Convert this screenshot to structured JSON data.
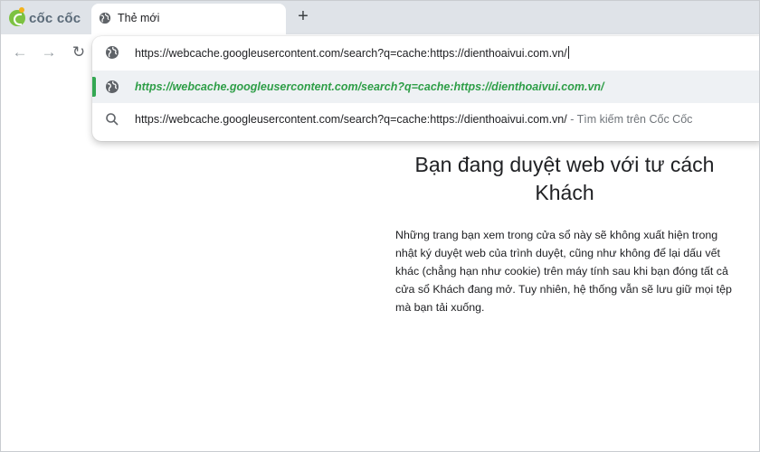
{
  "browser": {
    "brand": "cốc cốc",
    "tab": {
      "title": "Thẻ mới",
      "icon": "globe-icon"
    },
    "new_tab_icon": "+",
    "nav": {
      "back_icon": "←",
      "forward_icon": "→",
      "reload_icon": "↻"
    }
  },
  "omnibox": {
    "input_value": "https://webcache.googleusercontent.com/search?q=cache:https://dienthoaivui.com.vn/",
    "suggestions": [
      {
        "icon": "globe-icon",
        "text": "https://webcache.googleusercontent.com/search?q=cache:https://dienthoaivui.com.vn/"
      },
      {
        "icon": "search-icon",
        "text": "https://webcache.googleusercontent.com/search?q=cache:https://dienthoaivui.com.vn/",
        "hint": "- Tìm kiếm trên Cốc Cốc"
      }
    ]
  },
  "page": {
    "heading": "Bạn đang duyệt web với tư cách Khách",
    "body": "Những trang bạn xem trong cửa sổ này sẽ không xuất hiện trong nhật ký duyệt web của trình duyệt, cũng như không để lại dấu vết khác (chẳng hạn như cookie) trên máy tính sau khi bạn đóng tất cả cửa sổ Khách đang mở. Tuy nhiên, hệ thống vẫn sẽ lưu giữ mọi tệp mà bạn tải xuống."
  },
  "colors": {
    "accent": "#34a853",
    "titlebar": "#dfe3e8",
    "logo": "#7cc242"
  }
}
